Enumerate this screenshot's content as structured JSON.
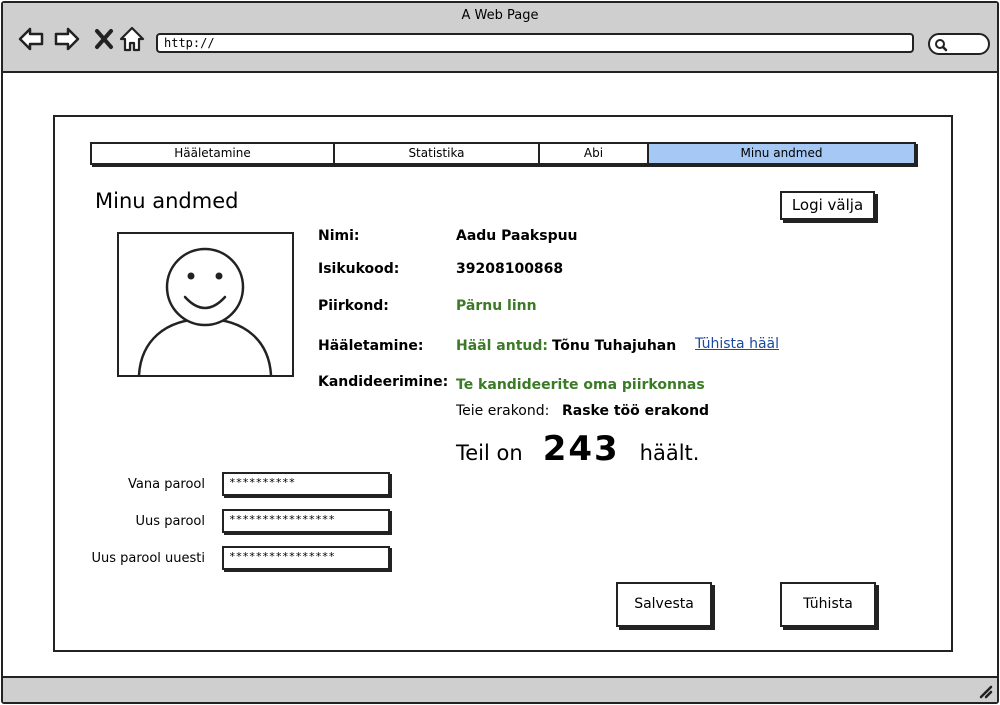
{
  "window": {
    "title": "A Web Page"
  },
  "browser": {
    "url": "http://",
    "icons": [
      "back-icon",
      "forward-icon",
      "close-icon",
      "home-icon",
      "search-icon"
    ]
  },
  "tabs": [
    {
      "label": "Hääletamine",
      "active": false
    },
    {
      "label": "Statistika",
      "active": false
    },
    {
      "label": "Abi",
      "active": false
    },
    {
      "label": "Minu andmed",
      "active": true
    }
  ],
  "page": {
    "title": "Minu andmed",
    "logout_label": "Logi välja"
  },
  "profile": {
    "name_label": "Nimi:",
    "name_value": "Aadu Paakspuu",
    "id_label": "Isikukood:",
    "id_value": "39208100868",
    "district_label": "Piirkond:",
    "district_value": "Pärnu linn",
    "voting_label": "Hääletamine:",
    "voting_status": "Hääl antud:",
    "voted_for": "Tõnu Tuhajuhan",
    "cancel_vote_link": "Tühista hääl",
    "candidacy_label": "Kandideerimine:",
    "candidacy_status": "Te kandideerite oma piirkonnas",
    "party_label": "Teie erakond:",
    "party_value": "Raske töö erakond",
    "votes_prefix": "Teil on",
    "votes_count": "243",
    "votes_suffix": "häält."
  },
  "password": {
    "old_label": "Vana parool",
    "old_value": "**********",
    "new_label": "Uus parool",
    "new_value": "****************",
    "repeat_label": "Uus parool uuesti",
    "repeat_value": "****************"
  },
  "actions": {
    "save_label": "Salvesta",
    "cancel_label": "Tühista"
  },
  "colors": {
    "active_tab": "#a6c8f5",
    "green_text": "#3b7a26",
    "link": "#1b4aa0",
    "chrome": "#cfcfcf"
  }
}
